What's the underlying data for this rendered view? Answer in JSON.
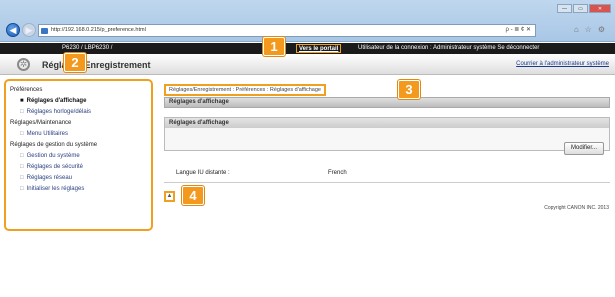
{
  "browser": {
    "url": "http://192.168.0.215/p_preference.html",
    "addr_tools": "ρ - ≣ ¢ ✕",
    "win_min": "—",
    "win_max": "▭",
    "win_close": "✕"
  },
  "device": {
    "model": "P6230 / LBP6230 /",
    "portal_link": "Vers le portail",
    "user_info": "Utilisateur de la connexion : Administrateur système  Se déconnecter"
  },
  "header": {
    "title": "Réglages/Enregistrement",
    "admin_link": "Courrier à l'administrateur système"
  },
  "sidebar": {
    "sections": [
      {
        "heading": "Préférences",
        "items": [
          {
            "label": "Réglages d'affichage",
            "active": true
          },
          {
            "label": "Réglages horloge/délais",
            "active": false
          }
        ]
      },
      {
        "heading": "Réglages/Maintenance",
        "items": [
          {
            "label": "Menu Utilitaires",
            "active": false
          }
        ]
      },
      {
        "heading": "Réglages de gestion du système",
        "items": [
          {
            "label": "Gestion du système",
            "active": false
          },
          {
            "label": "Réglages de sécurité",
            "active": false
          },
          {
            "label": "Réglages réseau",
            "active": false
          },
          {
            "label": "Initialiser les réglages",
            "active": false
          }
        ]
      }
    ]
  },
  "breadcrumb": "Réglages/Enregistrement : Préférences : Réglages d'affichage",
  "main": {
    "section_title": "Réglages d'affichage",
    "box_title": "Réglages d'affichage",
    "modify_button": "Modifier...",
    "field_label": "Langue IU distante :",
    "field_value": "French"
  },
  "copyright": "Copyright CANON INC. 2013",
  "callouts": [
    "1",
    "2",
    "3",
    "4"
  ],
  "colors": {
    "highlight": "#f0a020",
    "callout": "#f39a1e",
    "device_bar": "#1b1b1b"
  }
}
